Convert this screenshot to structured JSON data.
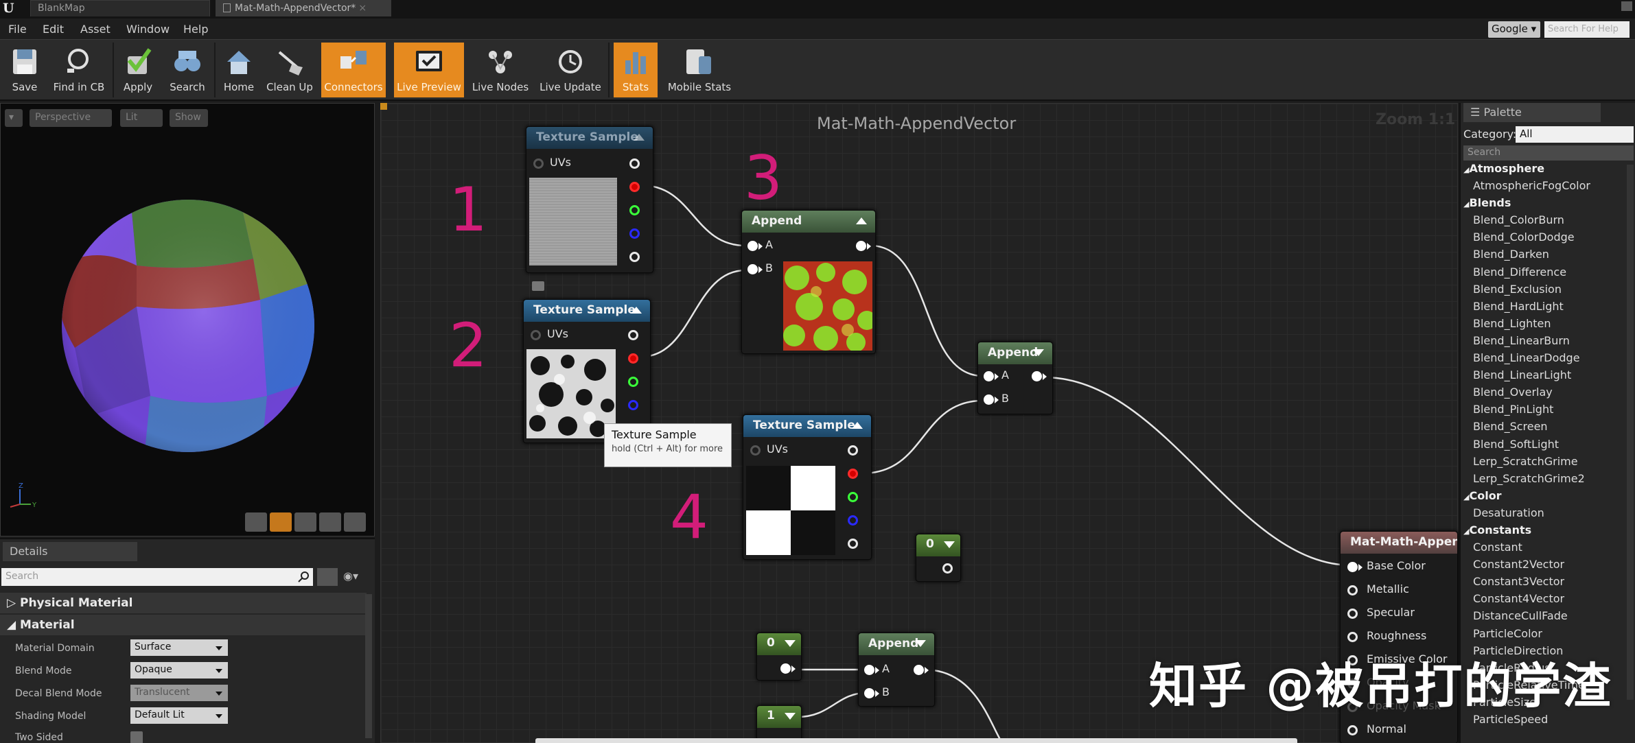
{
  "tabs": [
    {
      "label": "BlankMap"
    },
    {
      "label": "Mat-Math-AppendVector*",
      "close": "×"
    }
  ],
  "menu": [
    "File",
    "Edit",
    "Asset",
    "Window",
    "Help"
  ],
  "help_search": {
    "engine": "Google",
    "placeholder": "Search For Help"
  },
  "toolbar": {
    "buttons": [
      {
        "label": "Save",
        "icon": "save-icon"
      },
      {
        "label": "Find in CB",
        "icon": "find-in-cb-icon"
      },
      {
        "label": "Apply",
        "icon": "apply-check-icon"
      },
      {
        "label": "Search",
        "icon": "binoculars-icon"
      },
      {
        "label": "Home",
        "icon": "home-icon"
      },
      {
        "label": "Clean Up",
        "icon": "broom-icon"
      },
      {
        "label": "Connectors",
        "icon": "connectors-icon",
        "active": true
      },
      {
        "label": "Live Preview",
        "icon": "live-preview-icon",
        "active": true
      },
      {
        "label": "Live Nodes",
        "icon": "live-nodes-icon"
      },
      {
        "label": "Live Update",
        "icon": "live-update-icon"
      },
      {
        "label": "Stats",
        "icon": "stats-icon",
        "active": true
      },
      {
        "label": "Mobile Stats",
        "icon": "mobile-stats-icon"
      }
    ]
  },
  "viewport": {
    "buttons": [
      "Perspective",
      "Lit",
      "Show"
    ],
    "axis": {
      "z": "Z",
      "y": "Y"
    }
  },
  "details": {
    "tab": "Details",
    "search_placeholder": "Search",
    "sections": [
      "Physical Material",
      "Material"
    ],
    "properties": [
      {
        "name": "Material Domain",
        "value": "Surface"
      },
      {
        "name": "Blend Mode",
        "value": "Opaque"
      },
      {
        "name": "Decal Blend Mode",
        "value": "Translucent",
        "disabled": true
      },
      {
        "name": "Shading Model",
        "value": "Default Lit"
      },
      {
        "name": "Two Sided",
        "value": ""
      }
    ]
  },
  "graph": {
    "title": "Mat-Math-AppendVector",
    "zoom": "Zoom 1:1",
    "annotations": [
      "1",
      "2",
      "3",
      "4"
    ],
    "nodes": {
      "tex1": {
        "title": "Texture Sample",
        "uv": "UVs"
      },
      "tex2": {
        "title": "Texture Sample",
        "uv": "UVs"
      },
      "tex4": {
        "title": "Texture Sample",
        "uv": "UVs"
      },
      "append1": {
        "title": "Append",
        "a": "A",
        "b": "B"
      },
      "append2": {
        "title": "Append",
        "a": "A",
        "b": "B"
      },
      "append3": {
        "title": "Append",
        "a": "A",
        "b": "B"
      },
      "const0a": {
        "title": "0"
      },
      "const0b": {
        "title": "0"
      },
      "const1": {
        "title": "1"
      },
      "result": {
        "title": "Mat-Math-AppendV",
        "pins": [
          "Base Color",
          "Metallic",
          "Specular",
          "Roughness",
          "Emissive Color",
          "Opacity",
          "Opacity Mask",
          "Normal"
        ]
      }
    },
    "tooltip": {
      "title": "Texture Sample",
      "hint": "hold (Ctrl + Alt) for more"
    }
  },
  "palette": {
    "tab": "Palette",
    "category_label": "Category:",
    "category_value": "All",
    "search_placeholder": "Search",
    "items": [
      {
        "label": "Atmosphere",
        "cat": true
      },
      {
        "label": "AtmosphericFogColor"
      },
      {
        "label": "Blends",
        "cat": true
      },
      {
        "label": "Blend_ColorBurn"
      },
      {
        "label": "Blend_ColorDodge"
      },
      {
        "label": "Blend_Darken"
      },
      {
        "label": "Blend_Difference"
      },
      {
        "label": "Blend_Exclusion"
      },
      {
        "label": "Blend_HardLight"
      },
      {
        "label": "Blend_Lighten"
      },
      {
        "label": "Blend_LinearBurn"
      },
      {
        "label": "Blend_LinearDodge"
      },
      {
        "label": "Blend_LinearLight"
      },
      {
        "label": "Blend_Overlay"
      },
      {
        "label": "Blend_PinLight"
      },
      {
        "label": "Blend_Screen"
      },
      {
        "label": "Blend_SoftLight"
      },
      {
        "label": "Lerp_ScratchGrime"
      },
      {
        "label": "Lerp_ScratchGrime2"
      },
      {
        "label": "Color",
        "cat": true
      },
      {
        "label": "Desaturation"
      },
      {
        "label": "Constants",
        "cat": true
      },
      {
        "label": "Constant"
      },
      {
        "label": "Constant2Vector"
      },
      {
        "label": "Constant3Vector"
      },
      {
        "label": "Constant4Vector"
      },
      {
        "label": "DistanceCullFade"
      },
      {
        "label": "ParticleColor"
      },
      {
        "label": "ParticleDirection"
      },
      {
        "label": "ParticleRadius"
      },
      {
        "label": "ParticleRelativeTime"
      },
      {
        "label": "ParticleSize"
      },
      {
        "label": "ParticleSpeed"
      }
    ]
  },
  "watermark": "知乎 @被吊打的学渣",
  "colors": {
    "accent": "#e68a1f",
    "annotation": "#d21d79"
  }
}
